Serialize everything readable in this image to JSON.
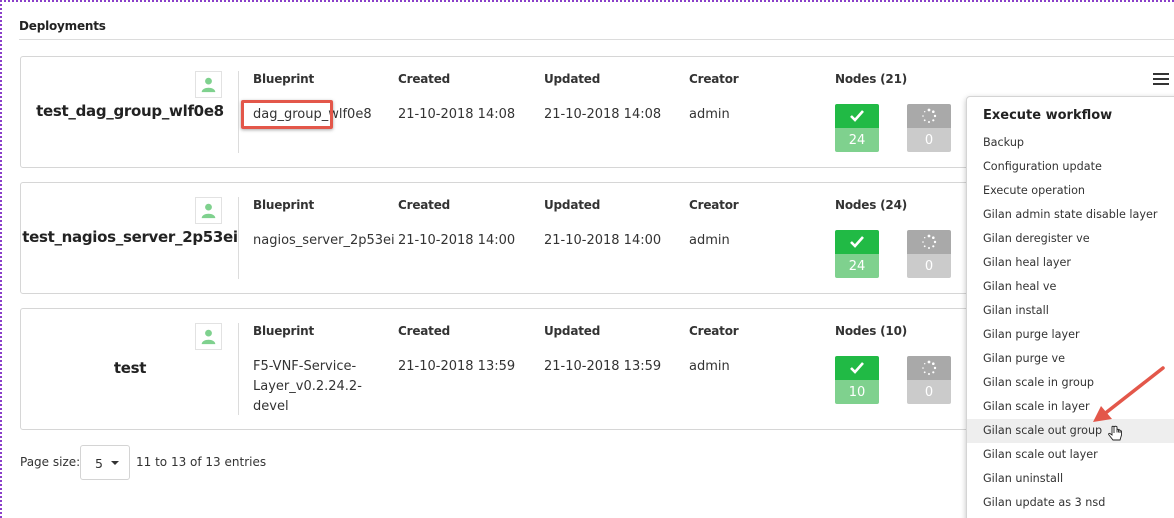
{
  "section": {
    "title": "Deployments"
  },
  "columns": {
    "blueprint": "Blueprint",
    "created": "Created",
    "updated": "Updated",
    "creator": "Creator"
  },
  "deployments": [
    {
      "name": "test_dag_group_wlf0e8",
      "blueprint": "dag_group_wlf0e8",
      "created": "21-10-2018 14:08",
      "updated": "21-10-2018 14:08",
      "creator": "admin",
      "nodes_label": "Nodes (21)",
      "ok_count": "24",
      "pending_count": "0"
    },
    {
      "name": "test_nagios_server_2p53ei",
      "blueprint": "nagios_server_2p53ei",
      "created": "21-10-2018 14:00",
      "updated": "21-10-2018 14:00",
      "creator": "admin",
      "nodes_label": "Nodes (24)",
      "ok_count": "24",
      "pending_count": "0"
    },
    {
      "name": "test",
      "blueprint": "F5-VNF-Service-Layer_v0.2.24.2-devel",
      "created": "21-10-2018 13:59",
      "updated": "21-10-2018 13:59",
      "creator": "admin",
      "nodes_label": "Nodes (10)",
      "ok_count": "10",
      "pending_count": "0"
    }
  ],
  "workflow_menu": {
    "header": "Execute workflow",
    "items": [
      "Backup",
      "Configuration update",
      "Execute operation",
      "Gilan admin state disable layer",
      "Gilan deregister ve",
      "Gilan heal layer",
      "Gilan heal ve",
      "Gilan install",
      "Gilan purge layer",
      "Gilan purge ve",
      "Gilan scale in group",
      "Gilan scale in layer",
      "Gilan scale out group",
      "Gilan scale out layer",
      "Gilan uninstall",
      "Gilan update as 3 nsd"
    ],
    "hovered_item": "Gilan scale out group"
  },
  "pagination": {
    "page_size_label": "Page size:",
    "page_size_value": "5",
    "entries_text": "11 to 13 of 13 entries"
  },
  "colors": {
    "success": "#21ba45",
    "success_light": "#7fd18e",
    "pending": "#a9a9a9",
    "annotation": "#e3574a"
  },
  "icons": {
    "avatar": "user-icon",
    "ok": "check-icon",
    "pending": "spinner-icon",
    "menu": "hamburger-menu-icon"
  }
}
